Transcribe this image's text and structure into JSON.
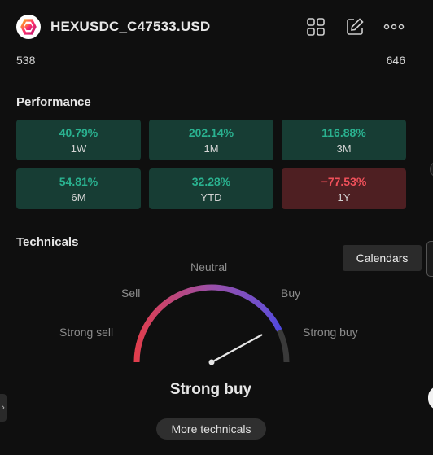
{
  "header": {
    "symbol": "HEXUSDC_C47533.USD",
    "icons": [
      "logo-icon",
      "grid-icon",
      "edit-icon",
      "more-icon"
    ]
  },
  "range": {
    "low": "538",
    "high": "646"
  },
  "performance": {
    "title": "Performance",
    "items": [
      {
        "value": "40.79%",
        "period": "1W",
        "trend": "up"
      },
      {
        "value": "202.14%",
        "period": "1M",
        "trend": "up"
      },
      {
        "value": "116.88%",
        "period": "3M",
        "trend": "up"
      },
      {
        "value": "54.81%",
        "period": "6M",
        "trend": "up"
      },
      {
        "value": "32.28%",
        "period": "YTD",
        "trend": "up"
      },
      {
        "value": "−77.53%",
        "period": "1Y",
        "trend": "down"
      }
    ]
  },
  "technicals": {
    "title": "Technicals",
    "labels": {
      "strong_sell": "Strong sell",
      "sell": "Sell",
      "neutral": "Neutral",
      "buy": "Buy",
      "strong_buy": "Strong buy"
    },
    "gauge_position": 0.86,
    "verdict": "Strong buy",
    "more_button": "More technicals"
  },
  "tooltip": {
    "text": "Calendars"
  },
  "colors": {
    "positive": "#2ab290",
    "negative": "#f0505a",
    "positive_bg": "#173d34",
    "negative_bg": "#4e1f22",
    "gauge_sell": "#e23d4b",
    "gauge_neutral": "#9a4fa8",
    "gauge_buy": "#5b4fd6"
  }
}
